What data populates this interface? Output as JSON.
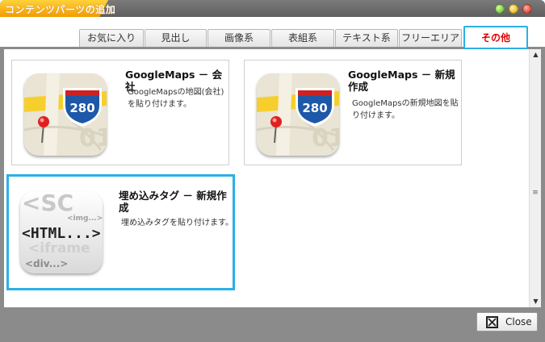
{
  "window": {
    "title": "コンテンツパーツの追加"
  },
  "tabs": [
    {
      "label": "お気に入り",
      "active": false
    },
    {
      "label": "見出し",
      "active": false
    },
    {
      "label": "画像系",
      "active": false
    },
    {
      "label": "表組系",
      "active": false
    },
    {
      "label": "テキスト系",
      "active": false
    },
    {
      "label": "フリーエリア",
      "active": false
    },
    {
      "label": "その他",
      "active": true
    }
  ],
  "cards": [
    {
      "title": "GoogleMaps － 会社",
      "desc": "GoogleMapsの地図(会社)を貼り付けます。",
      "icon": "google-maps-icon",
      "icon_text": "280",
      "selected": false
    },
    {
      "title": "GoogleMaps － 新規作成",
      "desc": "GoogleMapsの新規地図を貼り付けます。",
      "icon": "google-maps-icon",
      "icon_text": "280",
      "selected": false
    },
    {
      "title": "埋め込みタグ － 新規作成",
      "desc": "埋め込みタグを貼り付けます。",
      "icon": "html-tag-icon",
      "icon_text": "<HTML...>",
      "selected": true
    }
  ],
  "footer": {
    "close_label": "Close"
  },
  "colors": {
    "accent": "#2bb0e6",
    "active_tab_text": "#e00000",
    "title_orange": "#f29b00"
  }
}
